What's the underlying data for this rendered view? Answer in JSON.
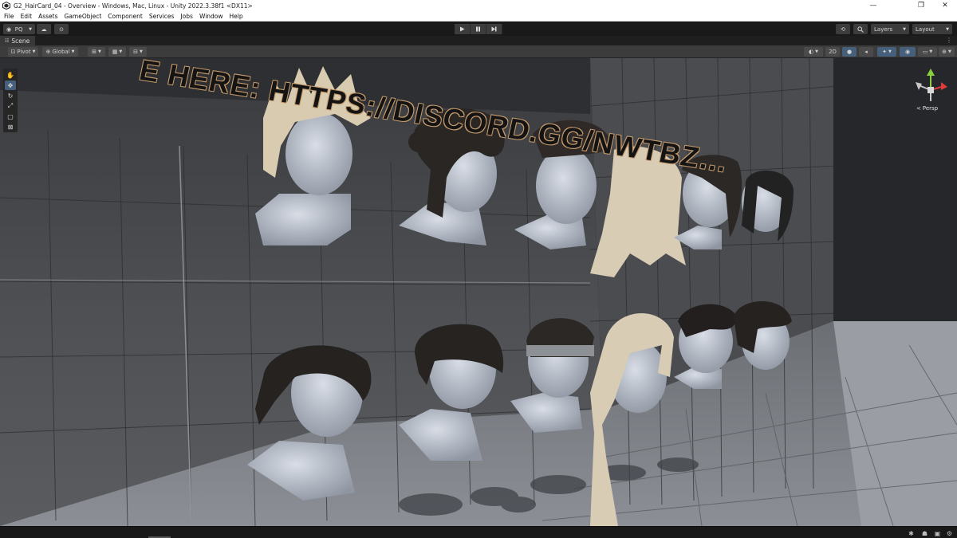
{
  "window": {
    "title": "G2_HairCard_04 - Overview - Windows, Mac, Linux - Unity 2022.3.38f1 <DX11>",
    "controls": [
      "—",
      "❐",
      "✕"
    ]
  },
  "menubar": {
    "items": [
      "File",
      "Edit",
      "Assets",
      "GameObject",
      "Component",
      "Services",
      "Jobs",
      "Window",
      "Help"
    ]
  },
  "toolbar": {
    "account_label": "PQ",
    "layers_label": "Layers",
    "layout_label": "Layout",
    "play_icon": "play-icon",
    "pause_icon": "pause-icon",
    "step_icon": "step-icon"
  },
  "scene_tab": {
    "label": "Scene",
    "menu_symbol": "⋮"
  },
  "scene_toolbar": {
    "pivot_label": "Pivot",
    "global_label": "Global",
    "mode_2d_label": "2D"
  },
  "viewport": {
    "wall_text": "E HERE: HTTPS://DISCORD.GG/NWTBZ…",
    "camera_label": "Persp",
    "accent_color": "#46607c",
    "axis_colors": {
      "x": "#e03c3c",
      "y": "#8bd13b",
      "z": "#3c7be0"
    }
  }
}
